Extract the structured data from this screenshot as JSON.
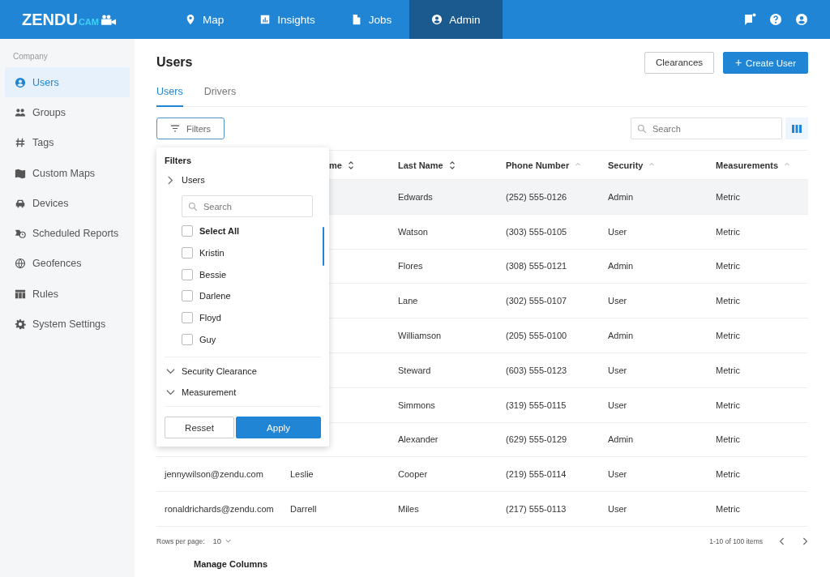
{
  "logo": {
    "word": "ZENDU",
    "accent": "CAM"
  },
  "nav": [
    {
      "label": "Map",
      "selected": false
    },
    {
      "label": "Insights",
      "selected": false
    },
    {
      "label": "Jobs",
      "selected": false
    },
    {
      "label": "Admin",
      "selected": true
    }
  ],
  "sidebar": {
    "heading": "Company",
    "items": [
      {
        "label": "Users",
        "selected": true
      },
      {
        "label": "Groups",
        "selected": false
      },
      {
        "label": "Tags",
        "selected": false
      },
      {
        "label": "Custom Maps",
        "selected": false
      },
      {
        "label": "Devices",
        "selected": false
      },
      {
        "label": "Scheduled Reports",
        "selected": false
      },
      {
        "label": "Geofences",
        "selected": false
      },
      {
        "label": "Rules",
        "selected": false
      },
      {
        "label": "System Settings",
        "selected": false
      }
    ]
  },
  "page": {
    "title": "Users",
    "buttons": [
      {
        "label": "Clearances",
        "kind": "outline"
      },
      {
        "label": "Create User",
        "kind": "primary",
        "plus": "+"
      }
    ],
    "tabs": [
      {
        "label": "Users",
        "selected": true
      },
      {
        "label": "Drivers",
        "selected": false
      }
    ],
    "filters_button": "Filters",
    "search": {
      "placeholder": "Search"
    }
  },
  "table": {
    "columns": [
      "me",
      "Last Name",
      "Phone Number",
      "Security",
      "Measurements"
    ],
    "rows": [
      {
        "selected": true,
        "last_name": "Edwards",
        "phone": "(252) 555-0126",
        "security": "Admin",
        "measurements": "Metric"
      },
      {
        "selected": false,
        "last_name": "Watson",
        "phone": "(303) 555-0105",
        "security": "User",
        "measurements": "Metric"
      },
      {
        "selected": false,
        "last_name": "Flores",
        "phone": "(308) 555-0121",
        "security": "Admin",
        "measurements": "Metric"
      },
      {
        "selected": false,
        "last_name": "Lane",
        "phone": "(302) 555-0107",
        "security": "User",
        "measurements": "Metric"
      },
      {
        "selected": false,
        "last_name": "Williamson",
        "phone": "(205) 555-0100",
        "security": "Admin",
        "measurements": "Metric"
      },
      {
        "selected": false,
        "last_name": "Steward",
        "phone": "(603) 555-0123",
        "security": "User",
        "measurements": "Metric"
      },
      {
        "selected": false,
        "last_name": "Simmons",
        "phone": "(319) 555-0115",
        "security": "User",
        "measurements": "Metric"
      },
      {
        "selected": false,
        "last_name": "Alexander",
        "phone": "(629) 555-0129",
        "security": "Admin",
        "measurements": "Metric"
      },
      {
        "selected": false,
        "email": "jennywilson@zendu.com",
        "first_name": "Leslie",
        "last_name": "Cooper",
        "phone": "(219) 555-0114",
        "security": "User",
        "measurements": "Metric"
      },
      {
        "selected": false,
        "email": "ronaldrichards@zendu.com",
        "first_name": "Darrell",
        "last_name": "Miles",
        "phone": "(217) 555-0113",
        "security": "User",
        "measurements": "Metric"
      }
    ]
  },
  "footer": {
    "rows_label": "Rows per page:",
    "rows_value": "10",
    "range": "1-10 of 100 items",
    "manage": "Manage Columns"
  },
  "filter_panel": {
    "title": "Filters",
    "sections": [
      {
        "label": "Users",
        "expanded": true,
        "search_placeholder": "Search",
        "options": [
          {
            "label": "Select All",
            "kind": "all",
            "checked": false
          },
          {
            "label": "Kristin",
            "kind": "name",
            "checked": false
          },
          {
            "label": "Bessie",
            "kind": "name",
            "checked": false
          },
          {
            "label": "Darlene",
            "kind": "name",
            "checked": false
          },
          {
            "label": "Floyd",
            "kind": "name",
            "checked": false
          },
          {
            "label": "Guy",
            "kind": "name",
            "checked": false
          }
        ]
      },
      {
        "label": "Security Clearance",
        "expanded": false
      },
      {
        "label": "Measurement",
        "expanded": false
      }
    ],
    "buttons": [
      {
        "label": "Resset",
        "kind": "outline"
      },
      {
        "label": "Apply",
        "kind": "primary"
      }
    ]
  }
}
